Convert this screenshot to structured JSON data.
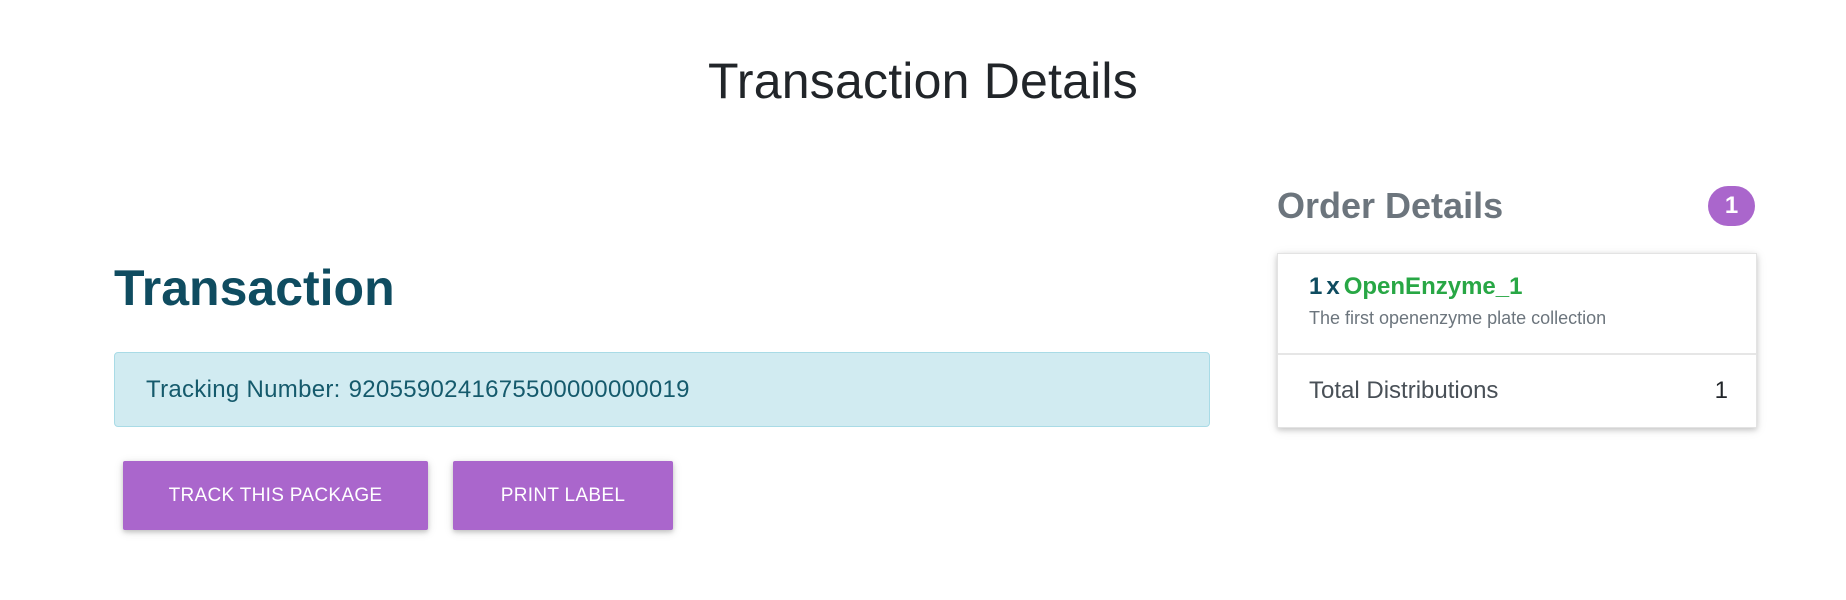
{
  "page": {
    "title": "Transaction Details"
  },
  "transaction": {
    "heading": "Transaction",
    "tracking_label": "Tracking Number:",
    "tracking_number": "9205590241675500000000019",
    "buttons": {
      "track": "TRACK THIS PACKAGE",
      "print": "PRINT LABEL"
    }
  },
  "order": {
    "heading": "Order Details",
    "badge_count": "1",
    "items": [
      {
        "quantity": "1",
        "separator": "x",
        "name": "OpenEnzyme_1",
        "description": "The first openenzyme plate collection"
      }
    ],
    "total_label": "Total Distributions",
    "total_value": "1"
  },
  "colors": {
    "accent_purple": "#aa66cc",
    "heading_teal": "#0f4c60",
    "item_green": "#28a745",
    "info_bg": "#d1ebf1"
  }
}
